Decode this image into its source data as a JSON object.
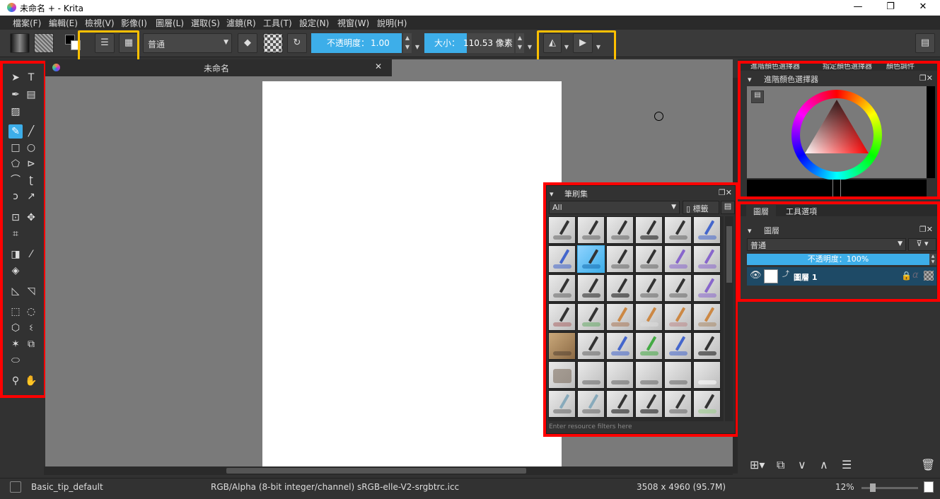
{
  "titlebar": {
    "title": "未命名 + - Krita",
    "minimize": "—",
    "restore": "❐",
    "close": "✕"
  },
  "menu": [
    "檔案(F)",
    "編輯(E)",
    "檢視(V)",
    "影像(I)",
    "圖層(L)",
    "選取(S)",
    "濾鏡(R)",
    "工具(T)",
    "設定(N)",
    "視窗(W)",
    "說明(H)"
  ],
  "toolbar": {
    "blend_mode": "普通",
    "opacity_label": "不透明度：",
    "opacity_value": "1.00",
    "size_label": "大小：",
    "size_value": "110.53 像素",
    "colors": {
      "accent": "#3daee9",
      "highlight_yellow": "#ffc000",
      "highlight_red": "#ff0000"
    }
  },
  "document": {
    "tab_title": "未命名",
    "close_icon": "pin-icon"
  },
  "brush_docker": {
    "title": "筆刷集",
    "filter": "All",
    "tag_label": "標籤",
    "search_placeholder": "Enter resource filters here"
  },
  "color_docker": {
    "tabs": [
      "進階顏色選擇器",
      "指定顏色選擇器",
      "顏色調件"
    ],
    "title": "進階顏色選擇器"
  },
  "layers_docker": {
    "tabs": [
      "圖層",
      "工具選項"
    ],
    "title": "圖層",
    "blend_mode": "普通",
    "opacity": "不透明度：100%",
    "layers": [
      {
        "name": "圖層 1"
      }
    ]
  },
  "statusbar": {
    "brush": "Basic_tip_default",
    "color_space": "RGB/Alpha (8-bit integer/channel)  sRGB-elle-V2-srgbtrc.icc",
    "dimensions": "3508 x 4960 (95.7M)",
    "zoom": "12%"
  }
}
